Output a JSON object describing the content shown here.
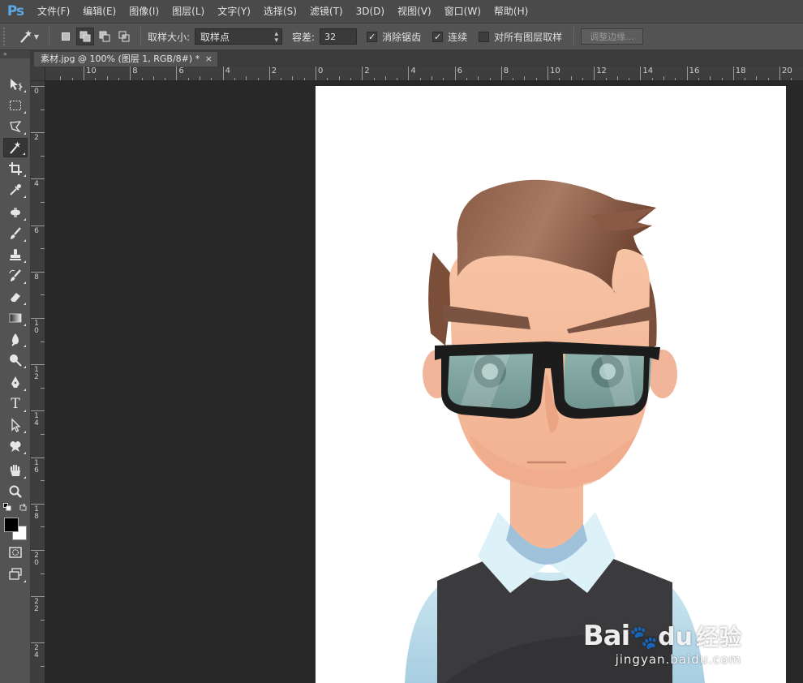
{
  "app": {
    "logo": "Ps"
  },
  "menu": [
    "文件(F)",
    "编辑(E)",
    "图像(I)",
    "图层(L)",
    "文字(Y)",
    "选择(S)",
    "滤镜(T)",
    "3D(D)",
    "视图(V)",
    "窗口(W)",
    "帮助(H)"
  ],
  "options": {
    "tool_icon": "magic-wand-icon",
    "sample_size_label": "取样大小:",
    "sample_size_value": "取样点",
    "tolerance_label": "容差:",
    "tolerance_value": "32",
    "antialias_label": "消除锯齿",
    "antialias_checked": true,
    "contiguous_label": "连续",
    "contiguous_checked": true,
    "sample_all_layers_label": "对所有图层取样",
    "sample_all_layers_checked": false,
    "refine_edge_label": "调整边缘..."
  },
  "toolbar": {
    "tools": [
      "move-icon",
      "marquee-icon",
      "lasso-icon",
      "magic-wand-icon",
      "crop-icon",
      "eyedropper-icon",
      "healing-brush-icon",
      "brush-icon",
      "clone-stamp-icon",
      "history-brush-icon",
      "eraser-icon",
      "gradient-icon",
      "blur-icon",
      "dodge-icon",
      "pen-icon",
      "type-icon",
      "path-selection-icon",
      "custom-shape-icon",
      "hand-icon",
      "zoom-icon"
    ],
    "active_tool": "magic-wand-icon",
    "type_tool_glyph": "T",
    "foreground_color": "#000000",
    "background_color": "#ffffff"
  },
  "document": {
    "tab_title": "素材.jpg @ 100% (图层 1, RGB/8#) *",
    "close_glyph": "×"
  },
  "rulers": {
    "horizontal_labels": [
      "2",
      "10",
      "8",
      "6",
      "4",
      "2",
      "0",
      "2",
      "4",
      "6",
      "8",
      "10",
      "12",
      "14",
      "16",
      "18",
      "20"
    ],
    "vertical_labels": [
      "0",
      "2",
      "4",
      "6",
      "8",
      "10",
      "12",
      "14",
      "16",
      "18",
      "20",
      "22",
      "24"
    ]
  },
  "watermark": {
    "logo": "Bai",
    "logo_suffix": "du",
    "brand_cn": "经验",
    "url": "jingyan.baidu.com"
  }
}
